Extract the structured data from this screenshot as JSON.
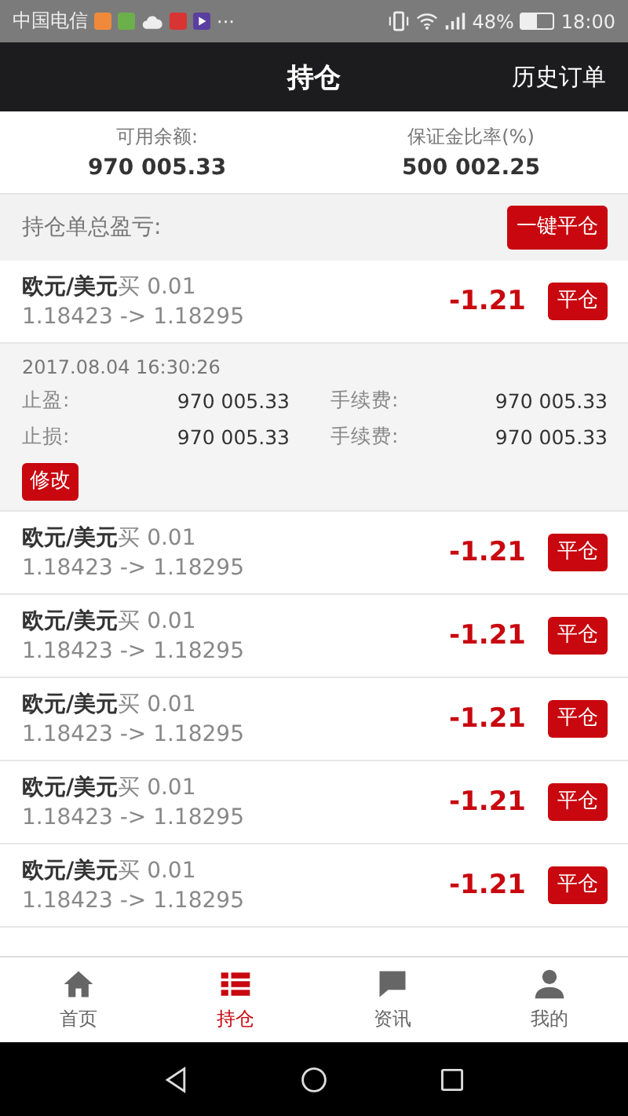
{
  "status_bar": {
    "carrier": "中国电信",
    "more": "···",
    "battery_text": "48%",
    "time": "18:00"
  },
  "header": {
    "title": "持仓",
    "action": "历史订单"
  },
  "summary": [
    {
      "label": "可用余额:",
      "value": "970 005.33"
    },
    {
      "label": "保证金比率(%)",
      "value": "500 002.25"
    }
  ],
  "total": {
    "label": "持仓单总盈亏:",
    "button": "一键平仓"
  },
  "orders": [
    {
      "pair": "欧元/美元",
      "side": "买",
      "lots": "0.01",
      "prices": "1.18423 -> 1.18295",
      "profit": "-1.21",
      "close": "平仓",
      "detail": {
        "time": "2017.08.04 16:30:26",
        "rows": [
          {
            "label": "止盈:",
            "value": "970 005.33",
            "fee_label": "手续费:",
            "fee": "970 005.33"
          },
          {
            "label": "止损:",
            "value": "970 005.33",
            "fee_label": "手续费:",
            "fee": "970 005.33"
          }
        ],
        "edit": "修改"
      }
    },
    {
      "pair": "欧元/美元",
      "side": "买",
      "lots": "0.01",
      "prices": "1.18423 -> 1.18295",
      "profit": "-1.21",
      "close": "平仓"
    },
    {
      "pair": "欧元/美元",
      "side": "买",
      "lots": "0.01",
      "prices": "1.18423 -> 1.18295",
      "profit": "-1.21",
      "close": "平仓"
    },
    {
      "pair": "欧元/美元",
      "side": "买",
      "lots": "0.01",
      "prices": "1.18423 -> 1.18295",
      "profit": "-1.21",
      "close": "平仓"
    },
    {
      "pair": "欧元/美元",
      "side": "买",
      "lots": "0.01",
      "prices": "1.18423 -> 1.18295",
      "profit": "-1.21",
      "close": "平仓"
    },
    {
      "pair": "欧元/美元",
      "side": "买",
      "lots": "0.01",
      "prices": "1.18423 -> 1.18295",
      "profit": "-1.21",
      "close": "平仓"
    }
  ],
  "tabs": [
    {
      "label": "首页",
      "kind": "home",
      "selected": false
    },
    {
      "label": "持仓",
      "kind": "list",
      "selected": true
    },
    {
      "label": "资讯",
      "kind": "chat",
      "selected": false
    },
    {
      "label": "我的",
      "kind": "person",
      "selected": false
    }
  ]
}
